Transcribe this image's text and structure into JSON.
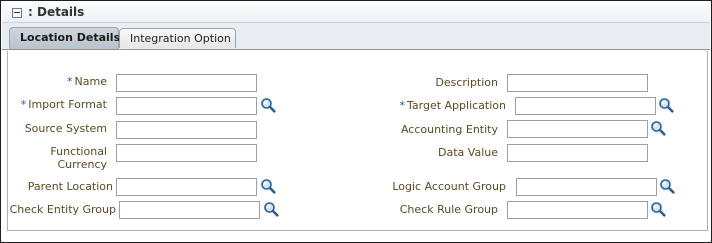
{
  "header": {
    "title": ": Details",
    "collapse_icon": "minus-box-icon"
  },
  "tabs": [
    {
      "label": "Location Details",
      "active": true
    },
    {
      "label": "Integration Option",
      "active": false
    }
  ],
  "fields_left": {
    "name": {
      "label": "Name",
      "required": "*",
      "value": ""
    },
    "import_format": {
      "label": "Import Format",
      "required": "*",
      "value": "",
      "icon": "search-icon"
    },
    "source_system": {
      "label": "Source System",
      "value": ""
    },
    "functional_currency": {
      "label_line1": "Functional",
      "label_line2": "Currency",
      "value": ""
    },
    "parent_location": {
      "label": "Parent Location",
      "value": "",
      "icon": "search-icon"
    },
    "check_entity_group": {
      "label": "Check Entity Group",
      "value": "",
      "icon": "search-icon"
    }
  },
  "fields_right": {
    "description": {
      "label": "Description",
      "value": ""
    },
    "target_application": {
      "label": "Target Application",
      "required": "*",
      "value": "",
      "icon": "search-icon"
    },
    "accounting_entity": {
      "label": "Accounting Entity",
      "value": "",
      "icon": "search-icon"
    },
    "data_value": {
      "label": "Data Value",
      "value": ""
    },
    "logic_account_group": {
      "label": "Logic Account Group",
      "value": "",
      "icon": "search-icon"
    },
    "check_rule_group": {
      "label": "Check Rule Group",
      "value": "",
      "icon": "search-icon"
    }
  },
  "colors": {
    "label": "#5a4a20",
    "required_asterisk": "#1d5b9a",
    "active_tab": "#c3ccd4",
    "frame_border": "#1f1f1f"
  }
}
